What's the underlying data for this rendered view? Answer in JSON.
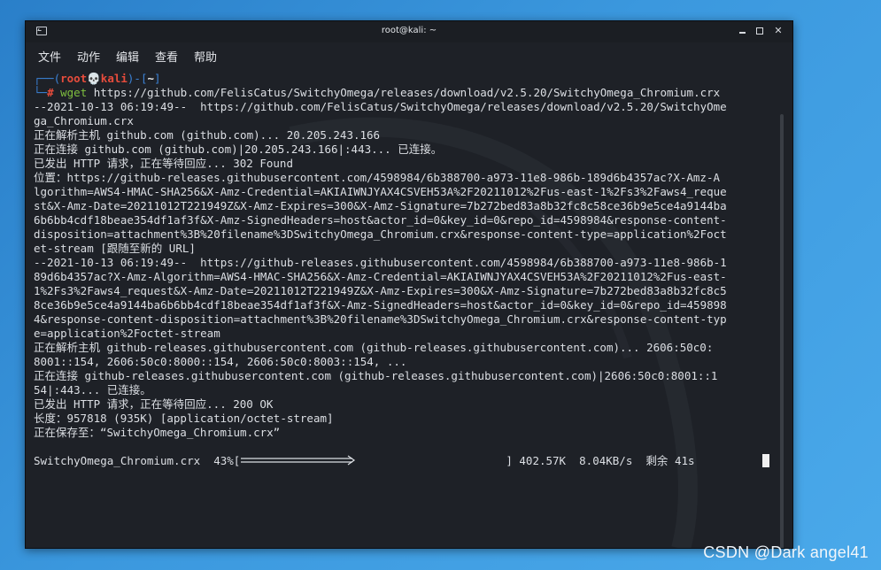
{
  "window": {
    "title": "root@kali: ~",
    "controls": {
      "minimize": "minimize-icon",
      "maximize": "maximize-icon",
      "close": "✕"
    }
  },
  "menu": [
    "文件",
    "动作",
    "编辑",
    "查看",
    "帮助"
  ],
  "prompt": {
    "top_left": "┌──(",
    "user": "root",
    "skull": "💀",
    "host": "kali",
    "dir_open": ")-[",
    "dir": "~",
    "dir_close": "]",
    "bottom_left": "└─",
    "hash": "#",
    "command": "wget",
    "url": "https://github.com/FelisCatus/SwitchyOmega/releases/download/v2.5.20/SwitchyOmega_Chromium.crx"
  },
  "output_lines": [
    "--2021-10-13 06:19:49--  https://github.com/FelisCatus/SwitchyOmega/releases/download/v2.5.20/SwitchyOme",
    "ga_Chromium.crx",
    "正在解析主机 github.com (github.com)... 20.205.243.166",
    "正在连接 github.com (github.com)|20.205.243.166|:443... 已连接。",
    "已发出 HTTP 请求，正在等待回应... 302 Found",
    "位置：https://github-releases.githubusercontent.com/4598984/6b388700-a973-11e8-986b-189d6b4357ac?X-Amz-A",
    "lgorithm=AWS4-HMAC-SHA256&X-Amz-Credential=AKIAIWNJYAX4CSVEH53A%2F20211012%2Fus-east-1%2Fs3%2Faws4_reque",
    "st&X-Amz-Date=20211012T221949Z&X-Amz-Expires=300&X-Amz-Signature=7b272bed83a8b32fc8c58ce36b9e5ce4a9144ba",
    "6b6bb4cdf18beae354df1af3f&X-Amz-SignedHeaders=host&actor_id=0&key_id=0&repo_id=4598984&response-content-",
    "disposition=attachment%3B%20filename%3DSwitchyOmega_Chromium.crx&response-content-type=application%2Foct",
    "et-stream [跟随至新的 URL]",
    "--2021-10-13 06:19:49--  https://github-releases.githubusercontent.com/4598984/6b388700-a973-11e8-986b-1",
    "89d6b4357ac?X-Amz-Algorithm=AWS4-HMAC-SHA256&X-Amz-Credential=AKIAIWNJYAX4CSVEH53A%2F20211012%2Fus-east-",
    "1%2Fs3%2Faws4_request&X-Amz-Date=20211012T221949Z&X-Amz-Expires=300&X-Amz-Signature=7b272bed83a8b32fc8c5",
    "8ce36b9e5ce4a9144ba6b6bb4cdf18beae354df1af3f&X-Amz-SignedHeaders=host&actor_id=0&key_id=0&repo_id=459898",
    "4&response-content-disposition=attachment%3B%20filename%3DSwitchyOmega_Chromium.crx&response-content-typ",
    "e=application%2Foctet-stream",
    "正在解析主机 github-releases.githubusercontent.com (github-releases.githubusercontent.com)... 2606:50c0:",
    "8001::154, 2606:50c0:8000::154, 2606:50c0:8003::154, ...",
    "正在连接 github-releases.githubusercontent.com (github-releases.githubusercontent.com)|2606:50c0:8001::1",
    "54|:443... 已连接。",
    "已发出 HTTP 请求，正在等待回应... 200 OK",
    "长度：957818 (935K) [application/octet-stream]",
    "正在保存至：“SwitchyOmega_Chromium.crx”",
    ""
  ],
  "progress": {
    "filename": "SwitchyOmega_Chromium.crx",
    "percent_label": "43%",
    "percent": 43,
    "bar_open": "[",
    "bar_close": "]",
    "size": "402.57K",
    "speed": "8.04KB/s",
    "remaining_label": "剩余",
    "eta": "41s"
  },
  "watermark": "CSDN @Dark angel41",
  "colors": {
    "desktop": "#3b98de",
    "terminal_bg": "#1e2127",
    "prompt_frame": "#3b82d6",
    "prompt_user": "#e74c3c",
    "command": "#7fbf3f",
    "text": "#dcdfe4"
  }
}
